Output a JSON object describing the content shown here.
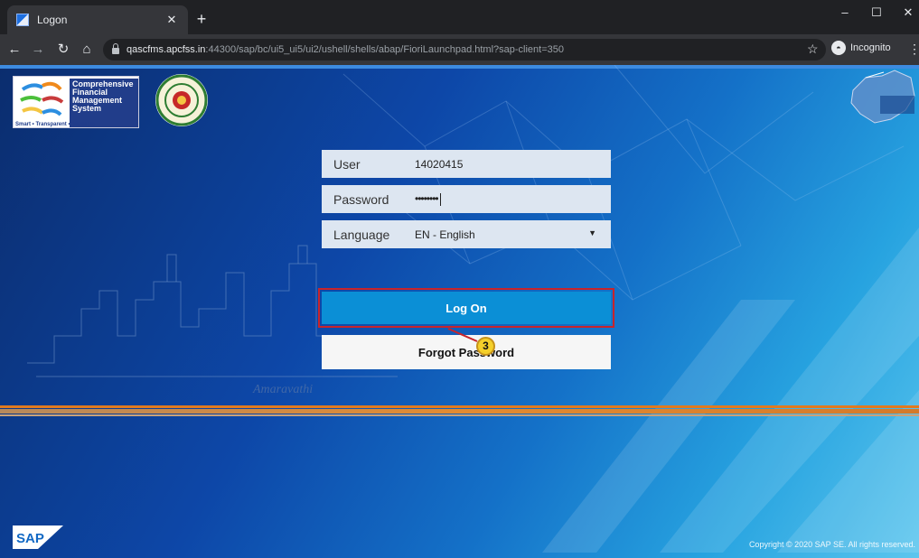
{
  "browser": {
    "tab_title": "Logon",
    "url_host": "qascfms.apcfss.in",
    "url_rest": ":44300/sap/bc/ui5_ui5/ui2/ushell/shells/abap/FioriLaunchpad.html?sap-client=350",
    "incognito_label": "Incognito"
  },
  "branding": {
    "cfms_lines": [
      "Comprehensive",
      "Financial",
      "Management",
      "System"
    ],
    "cfms_tagline": "Smart • Transparent • Strategic",
    "city_signature": "Amaravathi",
    "sap_logo_text": "SAP",
    "copyright": "Copyright © 2020 SAP SE. All rights reserved."
  },
  "login": {
    "user_label": "User",
    "user_value": "14020415",
    "password_label": "Password",
    "password_mask": "••••••••",
    "language_label": "Language",
    "language_value": "EN - English",
    "logon_button": "Log On",
    "forgot_button": "Forgot Password"
  },
  "annotation": {
    "step_number": "3"
  },
  "colors": {
    "logon_button": "#0b8fd6",
    "highlight_border": "#c8242b",
    "step_marker": "#f4d02b"
  }
}
